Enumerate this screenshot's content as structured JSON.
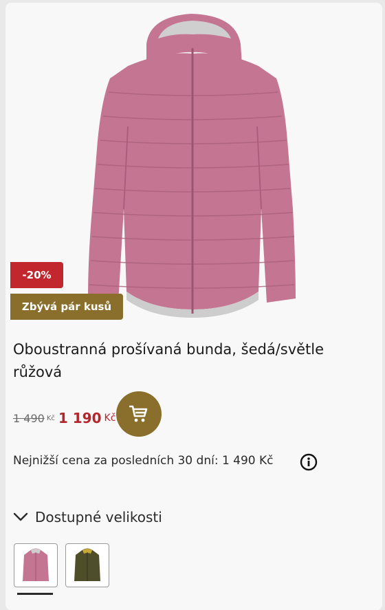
{
  "product": {
    "title": "Oboustranná prošívaná bunda, šedá/světle růžová",
    "discount_badge": "-20%",
    "stock_badge": "Zbývá pár kusů",
    "old_price": "1 490",
    "old_currency": "Kč",
    "new_price": "1 190",
    "new_currency": "Kč",
    "lowest_price_text": "Nejnižší cena za posledních 30 dní: 1 490 Kč",
    "sizes_label": "Dostupné velikosti",
    "selected_color_index": 0
  },
  "colors": {
    "discount": "#c1272d",
    "accent_gold": "#8a6f2c",
    "price_red": "#b3262c",
    "jacket_pink": "#c47591",
    "jacket_olive": "#4f4e2a"
  },
  "icons": {
    "cart": "shopping-cart-icon",
    "info": "info-icon",
    "chevron": "chevron-down-icon"
  }
}
